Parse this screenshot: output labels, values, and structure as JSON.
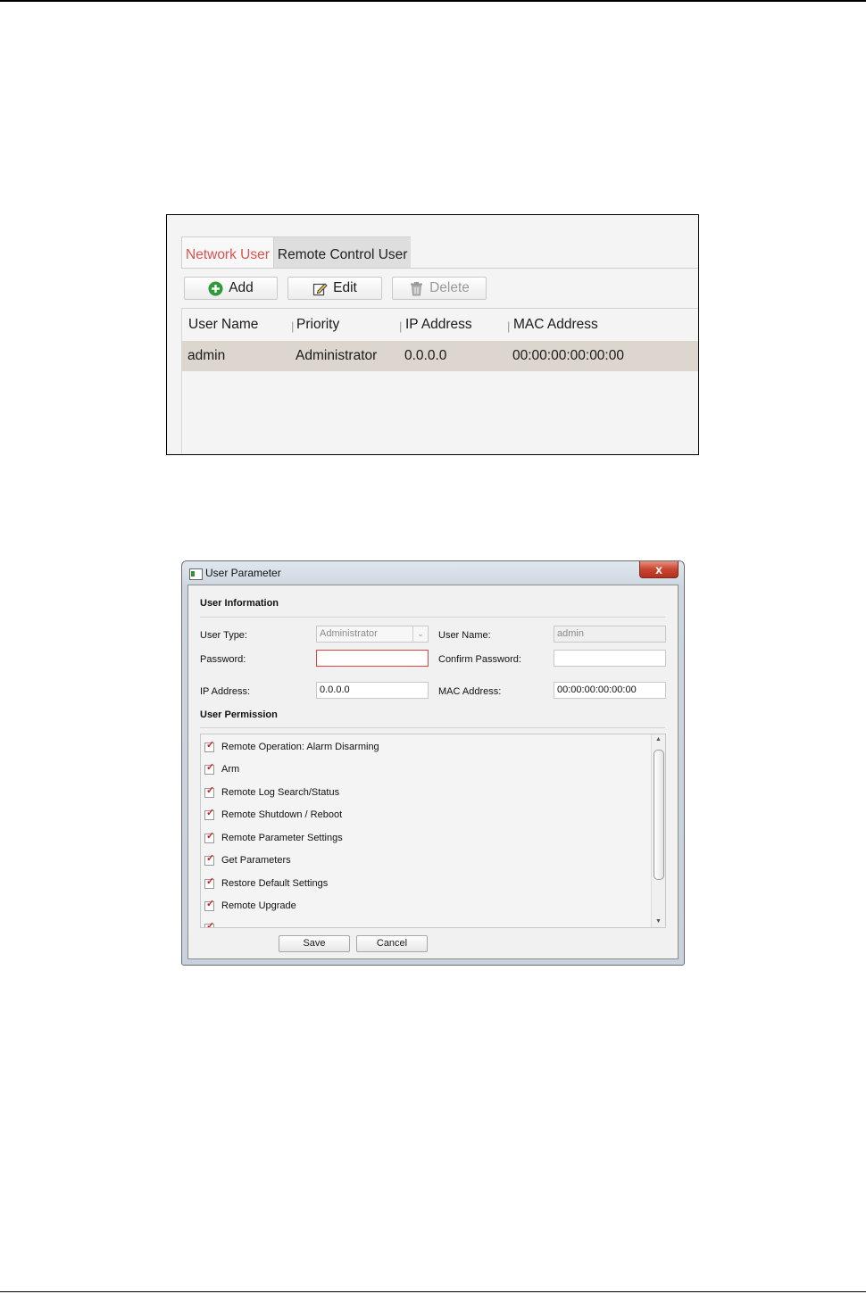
{
  "user_list_panel": {
    "tabs": [
      {
        "label": "Network User",
        "active": true
      },
      {
        "label": "Remote Control User",
        "active": false
      }
    ],
    "toolbar": {
      "add_label": "Add",
      "edit_label": "Edit",
      "delete_label": "Delete"
    },
    "columns": [
      "User Name",
      "Priority",
      "IP Address",
      "MAC Address"
    ],
    "rows": [
      {
        "user_name": "admin",
        "priority": "Administrator",
        "ip": "0.0.0.0",
        "mac": "00:00:00:00:00:00"
      }
    ]
  },
  "dialog": {
    "title": "User Parameter",
    "close_glyph": "x",
    "user_information": {
      "heading": "User Information",
      "user_type_label": "User Type:",
      "user_type_value": "Administrator",
      "user_name_label": "User Name:",
      "user_name_value": "admin",
      "password_label": "Password:",
      "password_value": "",
      "confirm_password_label": "Confirm Password:",
      "confirm_password_value": "",
      "ip_label": "IP Address:",
      "ip_value": "0.0.0.0",
      "mac_label": "MAC Address:",
      "mac_value": "00:00:00:00:00:00"
    },
    "user_permission": {
      "heading": "User Permission",
      "items": [
        {
          "label": "Remote Operation: Alarm Disarming",
          "checked": true
        },
        {
          "label": "Arm",
          "checked": true
        },
        {
          "label": "Remote Log Search/Status",
          "checked": true
        },
        {
          "label": "Remote Shutdown / Reboot",
          "checked": true
        },
        {
          "label": "Remote Parameter Settings",
          "checked": true
        },
        {
          "label": "Get Parameters",
          "checked": true
        },
        {
          "label": "Restore Default Settings",
          "checked": true
        },
        {
          "label": "Remote Upgrade",
          "checked": true
        }
      ]
    },
    "buttons": {
      "save_label": "Save",
      "cancel_label": "Cancel"
    },
    "colors": {
      "active_tab_text": "#d9534f",
      "selected_row": "#dcd6cf",
      "error_border": "#e04040",
      "checkmark": "#d02020",
      "close_button": "#c8452f"
    }
  }
}
